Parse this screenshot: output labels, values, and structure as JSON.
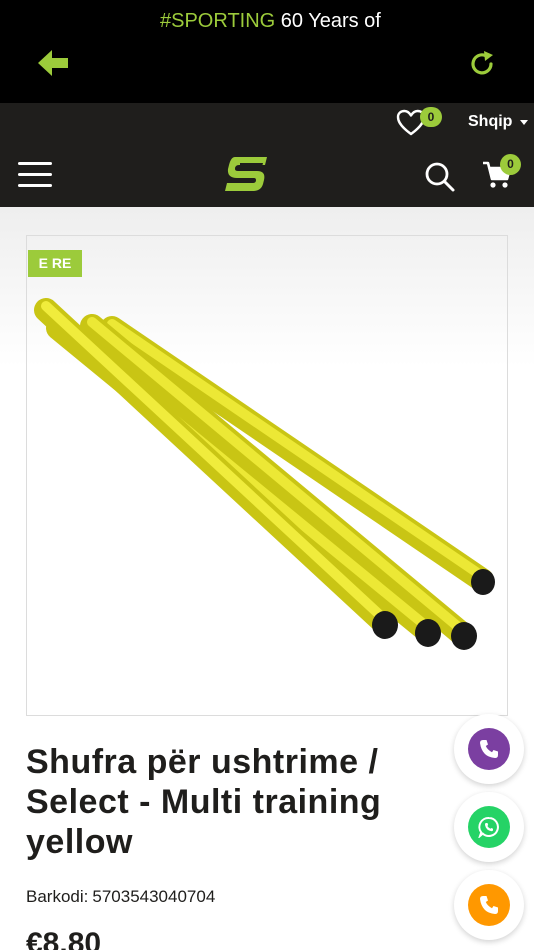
{
  "topbar": {
    "back_icon": "back-arrow-icon",
    "refresh_icon": "refresh-icon",
    "accent": "#9ccb3b"
  },
  "promo": {
    "hashtag": "#SPORTING",
    "text": " 60 Years of",
    "wishlist_count": "0",
    "language": "Shqip"
  },
  "nav": {
    "menu_icon": "hamburger-menu-icon",
    "logo": "sporting-logo",
    "search_icon": "search-icon",
    "cart_icon": "cart-icon",
    "cart_count": "0"
  },
  "product": {
    "badge": "E RE",
    "title": "Shufra për ushtrime / Select - Multi training yellow",
    "barcode_label": "Barkodi:",
    "barcode_value": "5703543040704",
    "price": "€8.80",
    "image_alt": "yellow training poles"
  },
  "contact": {
    "buttons": [
      {
        "icon": "phone-icon",
        "color": "#7b3fa1"
      },
      {
        "icon": "whatsapp-icon",
        "color": "#25d366"
      },
      {
        "icon": "phone-icon",
        "color": "#ff9800"
      }
    ]
  },
  "colors": {
    "dark": "#1f1e1c",
    "accent": "#9ccb3b"
  }
}
